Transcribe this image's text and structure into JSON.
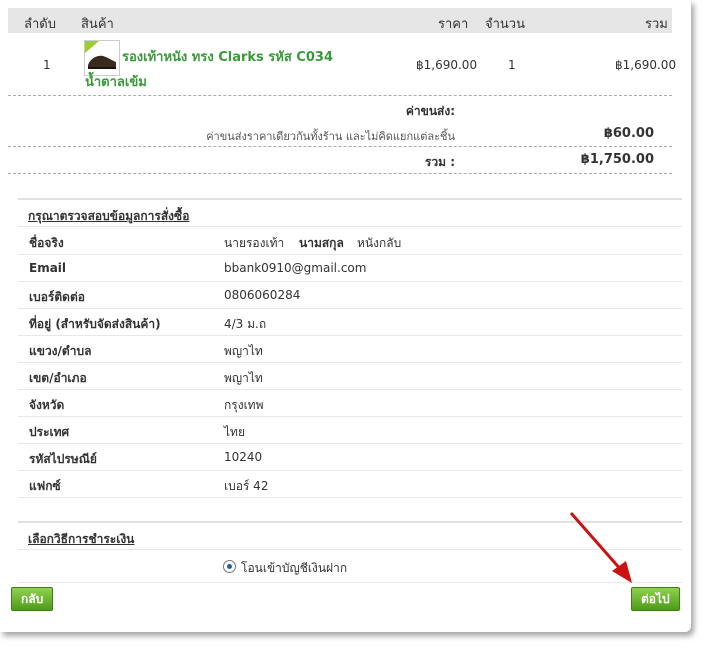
{
  "cart": {
    "headers": {
      "index": "ลำดับ",
      "product": "สินค้า",
      "price": "ราคา",
      "qty": "จำนวน",
      "total": "รวม"
    },
    "item": {
      "index": "1",
      "name": "รองเท้าหนัง ทรง Clarks รหัส C034 น้ำตาลเข้ม",
      "price": "฿1,690.00",
      "qty": "1",
      "total": "฿1,690.00"
    },
    "shipping_label": "ค่าขนส่ง:",
    "shipping_note": "ค่าขนส่งราคาเดียวกันทั้งร้าน และไม่คิดแยกแต่ละชิ้น",
    "shipping_value": "฿60.00",
    "grand_label": "รวม :",
    "grand_value": "฿1,750.00"
  },
  "order_info": {
    "title": "กรุณาตรวจสอบข้อมูลการสั่งซื้อ",
    "rows": [
      {
        "label": "ชื่อจริง",
        "value": "นายรองเท้า",
        "extra_label": "นามสกุล",
        "extra_value": "หนังกลับ"
      },
      {
        "label": "Email",
        "value": "bbank0910@gmail.com"
      },
      {
        "label": "เบอร์ติดต่อ",
        "value": "0806060284"
      },
      {
        "label": "ที่อยู่ (สำหรับจัดส่งสินค้า)",
        "value": "4/3 ม.ถ"
      },
      {
        "label": "แขวง/ตำบล",
        "value": "พญาไท"
      },
      {
        "label": "เขต/อำเภอ",
        "value": "พญาไท"
      },
      {
        "label": "จังหวัด",
        "value": "กรุงเทพ"
      },
      {
        "label": "ประเทศ",
        "value": "ไทย"
      },
      {
        "label": "รหัสไปรษณีย์",
        "value": "10240"
      },
      {
        "label": "แฟกซ์",
        "value": "เบอร์ 42"
      }
    ]
  },
  "payment": {
    "title": "เลือกวิธีการชำระเงิน",
    "option": "โอนเข้าบัญชีเงินฝาก"
  },
  "buttons": {
    "back": "กลับ",
    "next": "ต่อไป"
  },
  "colors": {
    "button_green": "#5aa625",
    "link_green": "#3a9a3a",
    "arrow_red": "#cc1111"
  }
}
